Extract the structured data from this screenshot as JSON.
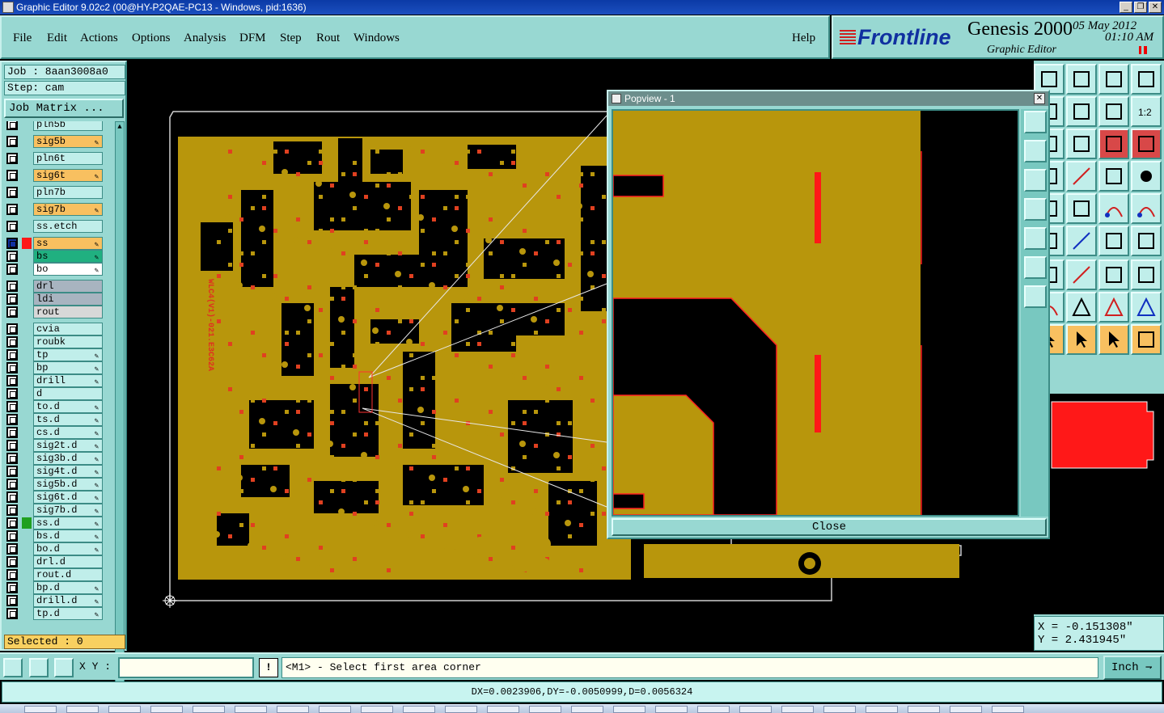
{
  "window": {
    "title": "Graphic Editor 9.02c2 (00@HY-P2QAE-PC13 - Windows, pid:1636)",
    "buttons": [
      "_",
      "❐",
      "✕"
    ]
  },
  "menu": {
    "items": [
      "File",
      "Edit",
      "Actions",
      "Options",
      "Analysis",
      "DFM",
      "Step",
      "Rout",
      "Windows"
    ],
    "help": "Help"
  },
  "brand": {
    "logo": "Frontline",
    "product": "Genesis 2000",
    "subtitle": "Graphic Editor",
    "date": "05 May 2012",
    "time": "01:10 AM"
  },
  "job": {
    "job_label": "Job : 8aan3008a0",
    "step_label": "Step: cam",
    "matrix_button": "Job Matrix ..."
  },
  "layers": [
    {
      "name": "pln5b",
      "style": "cyan",
      "editable": false
    },
    {
      "name": "sig5b",
      "style": "warm",
      "editable": true
    },
    {
      "name": "pln6t",
      "style": "cyan",
      "editable": false
    },
    {
      "name": "sig6t",
      "style": "warm",
      "editable": true
    },
    {
      "name": "pln7b",
      "style": "cyan",
      "editable": false
    },
    {
      "name": "sig7b",
      "style": "warm",
      "editable": true
    },
    {
      "name": "ss.etch",
      "style": "cyan",
      "editable": false
    },
    {
      "name": "ss",
      "style": "warm",
      "editable": true,
      "active": true
    },
    {
      "name": "bs",
      "style": "green",
      "editable": true
    },
    {
      "name": "bo",
      "style": "white",
      "editable": true
    },
    {
      "name": "drl",
      "style": "grey",
      "editable": false
    },
    {
      "name": "ldi",
      "style": "grey",
      "editable": false
    },
    {
      "name": "rout",
      "style": "lightgrey",
      "editable": false
    },
    {
      "name": "cvia",
      "style": "cyan",
      "editable": false
    },
    {
      "name": "roubk",
      "style": "cyan",
      "editable": false
    },
    {
      "name": "tp",
      "style": "cyan",
      "editable": true
    },
    {
      "name": "bp",
      "style": "cyan",
      "editable": true
    },
    {
      "name": "drill",
      "style": "cyan",
      "editable": true
    },
    {
      "name": "d",
      "style": "cyan",
      "editable": false
    },
    {
      "name": "to.d",
      "style": "cyan",
      "editable": true
    },
    {
      "name": "ts.d",
      "style": "cyan",
      "editable": true
    },
    {
      "name": "cs.d",
      "style": "cyan",
      "editable": true
    },
    {
      "name": "sig2t.d",
      "style": "cyan",
      "editable": true
    },
    {
      "name": "sig3b.d",
      "style": "cyan",
      "editable": true
    },
    {
      "name": "sig4t.d",
      "style": "cyan",
      "editable": true
    },
    {
      "name": "sig5b.d",
      "style": "cyan",
      "editable": true
    },
    {
      "name": "sig6t.d",
      "style": "cyan",
      "editable": true
    },
    {
      "name": "sig7b.d",
      "style": "cyan",
      "editable": true
    },
    {
      "name": "ss.d",
      "style": "cyan",
      "editable": true,
      "swatch": "#20a020"
    },
    {
      "name": "bs.d",
      "style": "cyan",
      "editable": true
    },
    {
      "name": "bo.d",
      "style": "cyan",
      "editable": true
    },
    {
      "name": "drl.d",
      "style": "cyan",
      "editable": false
    },
    {
      "name": "rout.d",
      "style": "cyan",
      "editable": false
    },
    {
      "name": "bp.d",
      "style": "cyan",
      "editable": true
    },
    {
      "name": "drill.d",
      "style": "cyan",
      "editable": true
    },
    {
      "name": "tp.d",
      "style": "cyan",
      "editable": true
    }
  ],
  "selected": "Selected : 0",
  "popview": {
    "title": "Popview - 1",
    "close_label": "Close"
  },
  "board_text": "WLC4(V1)-021.E3C62A",
  "coords": {
    "x": "X = -0.151308\"",
    "y": "Y = 2.431945\""
  },
  "bottom": {
    "xy_label": "X Y :",
    "xy_value": "",
    "info_glyph": "!",
    "prompt": "<M1> - Select first area corner",
    "units": "Inch",
    "units_arrow": "⇁"
  },
  "measure": "DX=0.0023906,DY=-0.0050999,D=0.0056324",
  "colors": {
    "copper": "#b8960c",
    "panel": "#98d8d2",
    "highlight_red": "#ff2020",
    "warm": "#f8c060"
  }
}
